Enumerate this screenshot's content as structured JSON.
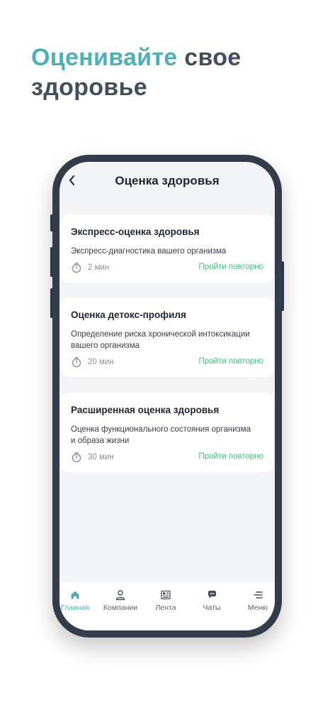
{
  "headline": {
    "accent": "Оценивайте",
    "rest_line1": "свое",
    "line2": "здоровье"
  },
  "screen": {
    "title": "Оценка здоровья",
    "back_icon": "chevron-left-icon"
  },
  "cards": [
    {
      "title": "Экспресс-оценка здоровья",
      "description": "Экспресс-диагностика вашего организма",
      "duration": "2 мин",
      "action": "Пройти повторно"
    },
    {
      "title": "Оценка детокс-профиля",
      "description": "Определение риска хронической интоксикации вашего организма",
      "duration": "20 мин",
      "action": "Пройти повторно"
    },
    {
      "title": "Расширенная оценка здоровья",
      "description": "Оценка функционального состояния организма и образа жизни",
      "duration": "30 мин",
      "action": "Пройти повторно"
    }
  ],
  "nav": {
    "items": [
      {
        "label": "Главная",
        "icon": "home-icon",
        "active": true
      },
      {
        "label": "Компании",
        "icon": "user-icon",
        "active": false
      },
      {
        "label": "Лента",
        "icon": "newspaper-icon",
        "active": false
      },
      {
        "label": "Чаты",
        "icon": "chat-icon",
        "active": false
      },
      {
        "label": "Меню",
        "icon": "menu-icon",
        "active": false
      }
    ]
  },
  "colors": {
    "accent": "#4cb0b6",
    "headline": "#434f5c",
    "frame": "#323c4b",
    "action_green": "#46c079",
    "screen_bg": "#f3f4f6"
  }
}
